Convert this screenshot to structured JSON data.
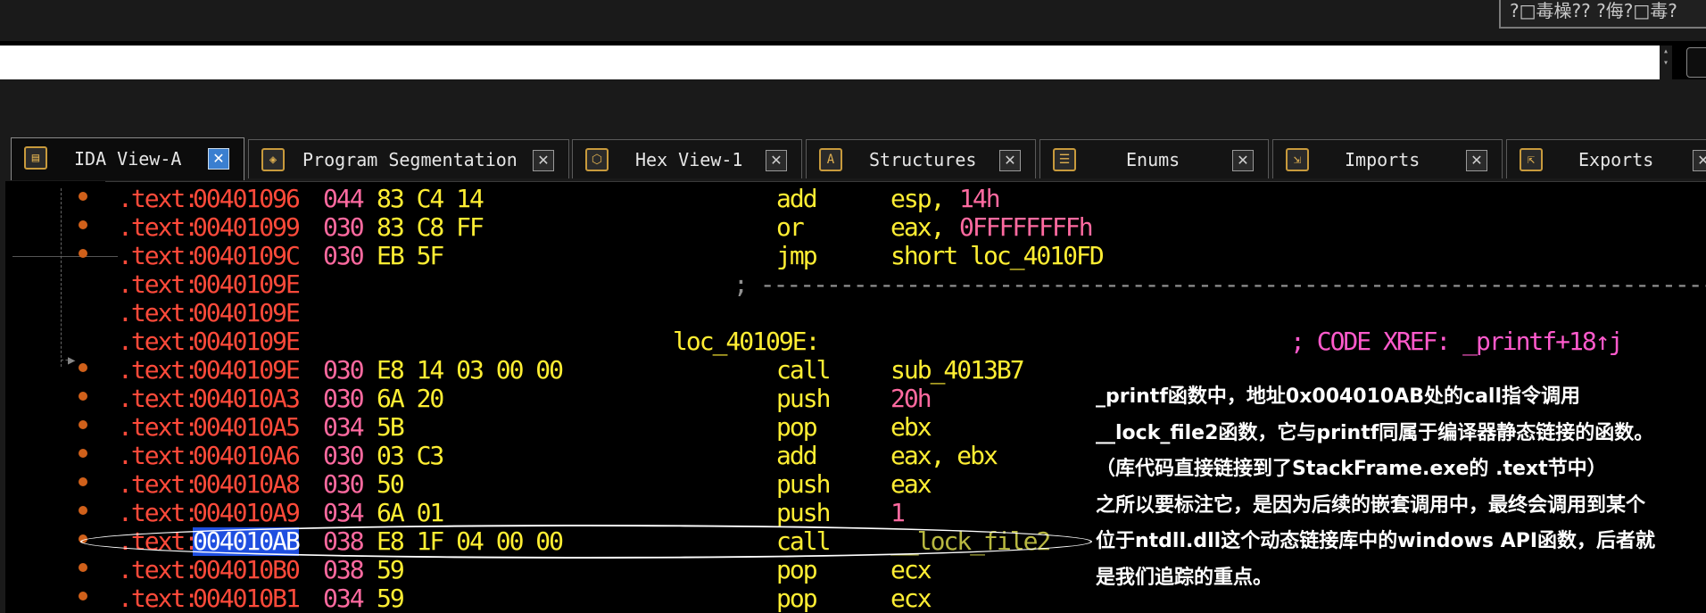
{
  "window": {
    "caption": "?□毒橾?? ?侮?□毒?"
  },
  "command_line": {
    "value": ""
  },
  "tabs": [
    {
      "label": "IDA View-A",
      "icon": "ida-view-icon",
      "active": true
    },
    {
      "label": "Program Segmentation",
      "icon": "segmentation-icon",
      "active": false
    },
    {
      "label": "Hex View-1",
      "icon": "hex-view-icon",
      "active": false
    },
    {
      "label": "Structures",
      "icon": "structures-icon",
      "active": false
    },
    {
      "label": "Enums",
      "icon": "enums-icon",
      "active": false
    },
    {
      "label": "Imports",
      "icon": "imports-icon",
      "active": false
    },
    {
      "label": "Exports",
      "icon": "exports-icon",
      "active": false
    }
  ],
  "listing": [
    {
      "seg": ".text:",
      "addr": "00401096",
      "sp": "044",
      "bytes": "83 C4 14",
      "label": "",
      "mnem": "add",
      "ops": "esp, ",
      "num": "14h",
      "cmt": "",
      "breakpoint": true
    },
    {
      "seg": ".text:",
      "addr": "00401099",
      "sp": "030",
      "bytes": "83 C8 FF",
      "label": "",
      "mnem": "or",
      "ops": "eax, ",
      "num": "0FFFFFFFFh",
      "cmt": "",
      "breakpoint": true
    },
    {
      "seg": ".text:",
      "addr": "0040109C",
      "sp": "030",
      "bytes": "EB 5F",
      "label": "",
      "mnem": "jmp",
      "ops": "short loc_4010FD",
      "num": "",
      "cmt": "",
      "breakpoint": true
    },
    {
      "seg": ".text:",
      "addr": "0040109E",
      "sp": "",
      "bytes": "",
      "label": "; ---------------------------------------------------------------------------------------------------",
      "mnem": "",
      "ops": "",
      "num": "",
      "cmt": "",
      "breakpoint": false
    },
    {
      "seg": ".text:",
      "addr": "0040109E",
      "sp": "",
      "bytes": "",
      "label": "",
      "mnem": "",
      "ops": "",
      "num": "",
      "cmt": "",
      "breakpoint": false
    },
    {
      "seg": ".text:",
      "addr": "0040109E",
      "sp": "",
      "bytes": "",
      "label": "loc_40109E:",
      "mnem": "",
      "ops": "",
      "num": "",
      "cmt": "; CODE XREF: _printf+18↑j",
      "breakpoint": false
    },
    {
      "seg": ".text:",
      "addr": "0040109E",
      "sp": "030",
      "bytes": "E8 14 03 00 00",
      "label": "",
      "mnem": "call",
      "ops": "sub_4013B7",
      "num": "",
      "cmt": "",
      "breakpoint": true
    },
    {
      "seg": ".text:",
      "addr": "004010A3",
      "sp": "030",
      "bytes": "6A 20",
      "label": "",
      "mnem": "push",
      "ops": "",
      "num": "20h",
      "cmt": "",
      "breakpoint": true
    },
    {
      "seg": ".text:",
      "addr": "004010A5",
      "sp": "034",
      "bytes": "5B",
      "label": "",
      "mnem": "pop",
      "ops": "ebx",
      "num": "",
      "cmt": "",
      "breakpoint": true
    },
    {
      "seg": ".text:",
      "addr": "004010A6",
      "sp": "030",
      "bytes": "03 C3",
      "label": "",
      "mnem": "add",
      "ops": "eax, ebx",
      "num": "",
      "cmt": "",
      "breakpoint": true
    },
    {
      "seg": ".text:",
      "addr": "004010A8",
      "sp": "030",
      "bytes": "50",
      "label": "",
      "mnem": "push",
      "ops": "eax",
      "num": "",
      "cmt": "",
      "breakpoint": true
    },
    {
      "seg": ".text:",
      "addr": "004010A9",
      "sp": "034",
      "bytes": "6A 01",
      "label": "",
      "mnem": "push",
      "ops": "",
      "num": "1",
      "cmt": "",
      "breakpoint": true
    },
    {
      "seg": ".text:",
      "addr": "004010AB",
      "sp": "038",
      "bytes": "E8 1F 04 00 00",
      "label": "",
      "mnem": "call",
      "ops": "",
      "num": "",
      "lib": "__lock_file2",
      "cmt": "",
      "breakpoint": true,
      "highlight": true
    },
    {
      "seg": ".text:",
      "addr": "004010B0",
      "sp": "038",
      "bytes": "59",
      "label": "",
      "mnem": "pop",
      "ops": "ecx",
      "num": "",
      "cmt": "",
      "breakpoint": true
    },
    {
      "seg": ".text:",
      "addr": "004010B1",
      "sp": "034",
      "bytes": "59",
      "label": "",
      "mnem": "pop",
      "ops": "ecx",
      "num": "",
      "cmt": "",
      "breakpoint": true
    }
  ],
  "annotation": {
    "lines": [
      "_printf函数中，地址0x004010AB处的call指令调用",
      "__lock_file2函数，它与printf同属于编译器静态链接的函数。",
      "（库代码直接链接到了StackFrame.exe的 .text节中）",
      "之所以要标注它，是因为后续的嵌套调用中，最终会调用到某个",
      "位于ntdll.dll这个动态链接库中的windows API函数，后者就",
      "是我们追踪的重点。"
    ]
  },
  "colors": {
    "background": "#000000",
    "segment_address": "#ff4a3a",
    "bytes_and_mnemonic": "#ffee33",
    "immediate": "#ff6aa0",
    "comment": "#ff5acc",
    "highlight": "#1f4fe0",
    "breakpoint": "#d0601a"
  }
}
